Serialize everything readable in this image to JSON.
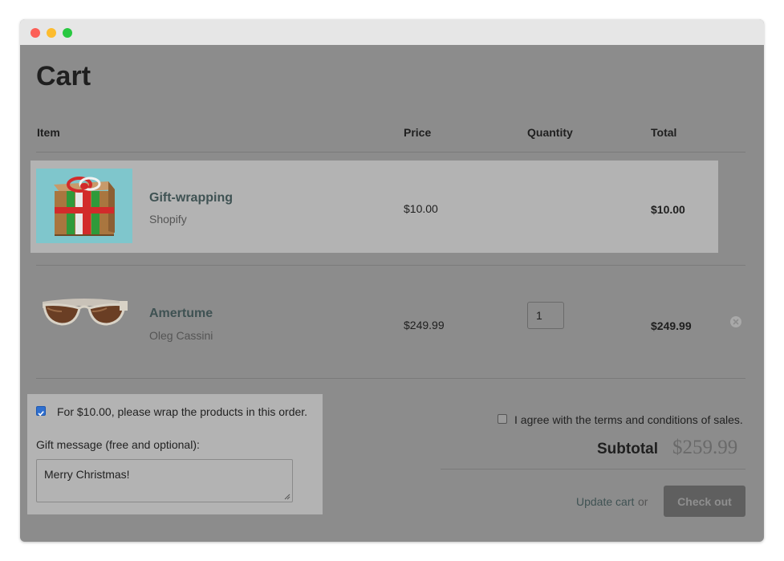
{
  "page": {
    "title": "Cart"
  },
  "table": {
    "headers": {
      "item": "Item",
      "price": "Price",
      "quantity": "Quantity",
      "total": "Total"
    }
  },
  "items": [
    {
      "name": "Gift-wrapping",
      "vendor": "Shopify",
      "price": "$10.00",
      "quantity": null,
      "total": "$10.00",
      "image": "gift-box-icon",
      "highlighted": true
    },
    {
      "name": "Amertume",
      "vendor": "Oleg Cassini",
      "price": "$249.99",
      "quantity": "1",
      "total": "$249.99",
      "image": "sunglasses-icon",
      "highlighted": false
    }
  ],
  "gift": {
    "wrap_checked": true,
    "wrap_label": "For $10.00, please wrap the products in this order.",
    "message_label": "Gift message (free and optional):",
    "message_value": "Merry Christmas!"
  },
  "summary": {
    "terms_checked": false,
    "terms_label": "I agree with the terms and conditions of sales.",
    "subtotal_label": "Subtotal",
    "subtotal_value": "$259.99",
    "update_label": "Update cart",
    "or_text": "or",
    "checkout_label": "Check out"
  },
  "colors": {
    "overlay": "#8c8c8c",
    "highlight": "#b3b3b3",
    "link": "#3f5253",
    "checkbox": "#2f6fcf"
  }
}
